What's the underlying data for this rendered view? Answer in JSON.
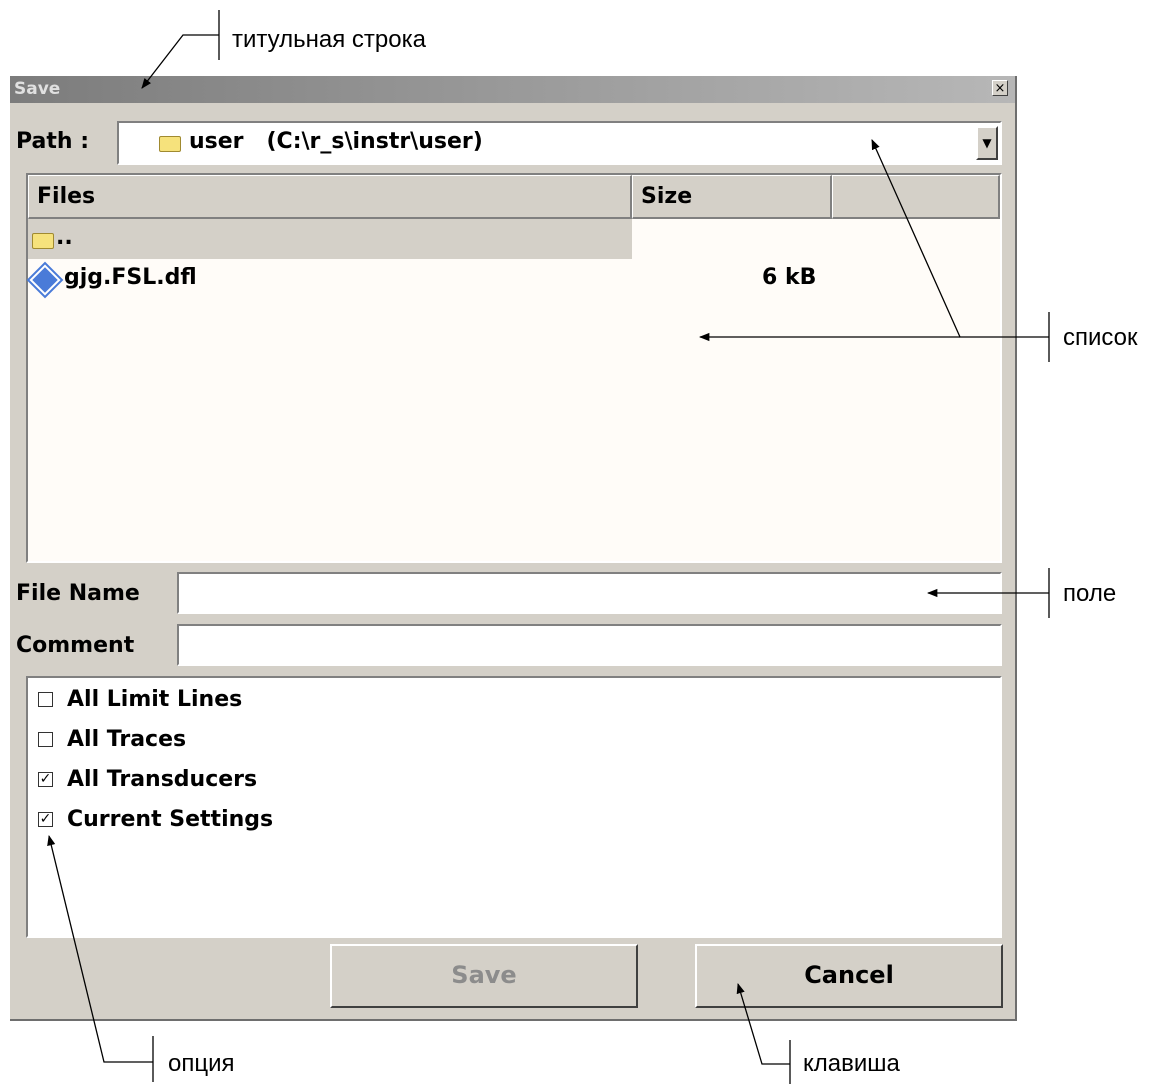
{
  "callouts": {
    "title_bar": "титульная строка",
    "list": "список",
    "field": "поле",
    "option": "опция",
    "key": "клавиша"
  },
  "dialog": {
    "title": "Save",
    "close_glyph": "×",
    "path_label": "Path :",
    "path_value": "user   (C:\\r_s\\instr\\user)",
    "dropdown_glyph": "▼",
    "columns": [
      "Files",
      "Size",
      ""
    ],
    "files": [
      {
        "name": "..",
        "size": "",
        "icon": "folder-icon",
        "selected": true
      },
      {
        "name": "gjg.FSL.dfl",
        "size": "6 kB",
        "icon": "dfl-file-icon",
        "selected": false
      }
    ],
    "file_name_label": "File Name",
    "file_name_value": "",
    "comment_label": "Comment",
    "comment_value": "",
    "options": [
      {
        "label": "All Limit Lines",
        "checked": false
      },
      {
        "label": "All Traces",
        "checked": false
      },
      {
        "label": "All Transducers",
        "checked": true
      },
      {
        "label": "Current Settings",
        "checked": true
      }
    ],
    "save_label": "Save",
    "save_enabled": false,
    "cancel_label": "Cancel"
  }
}
